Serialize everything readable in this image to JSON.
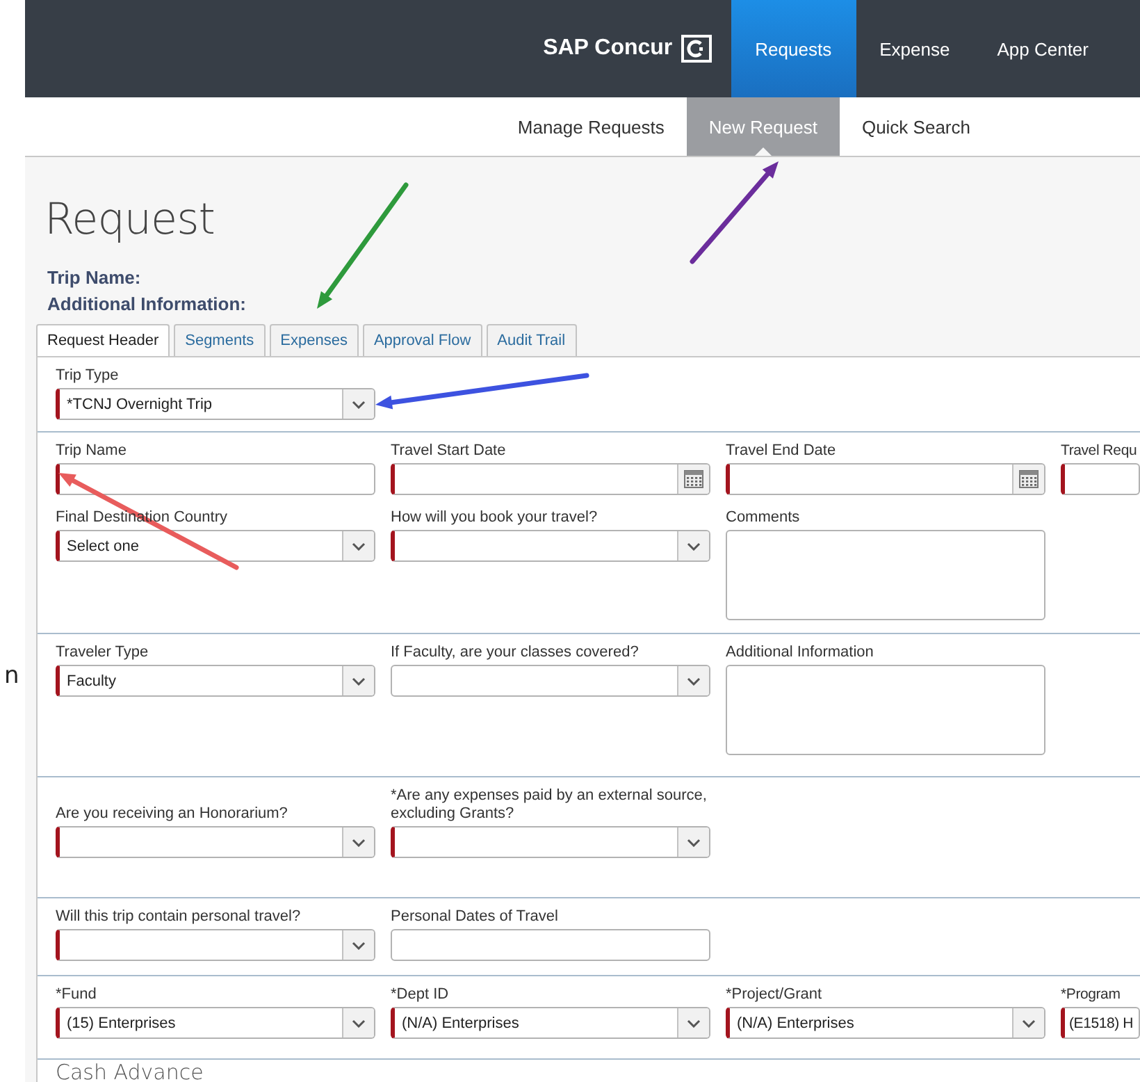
{
  "side_text": "n",
  "top_bar": {
    "logo": "SAP Concur",
    "nav": [
      {
        "label": "Requests",
        "selected": true
      },
      {
        "label": "Expense",
        "selected": false
      },
      {
        "label": "App Center",
        "selected": false
      }
    ]
  },
  "sub_nav": [
    {
      "label": "Manage Requests",
      "selected": false
    },
    {
      "label": "New Request",
      "selected": true
    },
    {
      "label": "Quick Search",
      "selected": false
    }
  ],
  "page_title": "Request",
  "header_labels": [
    "Trip Name:",
    "Additional Information:"
  ],
  "tabs": [
    {
      "label": "Request Header",
      "selected": true
    },
    {
      "label": "Segments",
      "selected": false
    },
    {
      "label": "Expenses",
      "selected": false
    },
    {
      "label": "Approval Flow",
      "selected": false
    },
    {
      "label": "Audit Trail",
      "selected": false
    }
  ],
  "sections": [
    {
      "rows": [
        [
          {
            "label": "Trip Type",
            "kind": "select",
            "value": "*TCNJ Overnight Trip",
            "required": true
          }
        ]
      ]
    },
    {
      "rows": [
        [
          {
            "label": "Trip Name",
            "kind": "text",
            "required": true
          },
          {
            "label": "Travel Start Date",
            "kind": "date",
            "required": true
          },
          {
            "label": "Travel End Date",
            "kind": "date",
            "required": true
          },
          {
            "label": "Travel Requ",
            "kind": "text",
            "required": true
          }
        ],
        [
          {
            "label": "Final Destination Country",
            "kind": "select",
            "value": "Select one",
            "required": true
          },
          {
            "label": "How will you book your travel?",
            "kind": "select",
            "required": true
          },
          {
            "label": "Comments",
            "kind": "textarea",
            "required": false
          }
        ]
      ]
    },
    {
      "rows": [
        [
          {
            "label": "Traveler Type",
            "kind": "select",
            "value": "Faculty",
            "required": true
          },
          {
            "label": "If Faculty, are your classes covered?",
            "kind": "select",
            "required": false
          },
          {
            "label": "Additional Information",
            "kind": "textarea",
            "required": false
          }
        ]
      ]
    },
    {
      "rows": [
        [
          {
            "label": "Are you receiving an Honorarium?",
            "kind": "select",
            "required": true
          },
          {
            "label": "*Are any expenses paid by an external source, excluding Grants?",
            "kind": "select",
            "required": true
          }
        ]
      ]
    },
    {
      "rows": [
        [
          {
            "label": "Will this trip contain personal travel?",
            "kind": "select",
            "required": true
          },
          {
            "label": "Personal Dates of Travel",
            "kind": "text",
            "required": false
          }
        ]
      ]
    },
    {
      "rows": [
        [
          {
            "label": "*Fund",
            "kind": "select",
            "value": "(15) Enterprises",
            "required": true
          },
          {
            "label": "*Dept ID",
            "kind": "select",
            "value": "(N/A) Enterprises",
            "required": true
          },
          {
            "label": "*Project/Grant",
            "kind": "select",
            "value": "(N/A) Enterprises",
            "required": true
          },
          {
            "label": "*Program",
            "kind": "text",
            "value": "(E1518) H",
            "required": true
          }
        ]
      ]
    }
  ],
  "next_section_title": "Cash Advance",
  "annotation_arrows": [
    {
      "color": "#2e9a3c"
    },
    {
      "color": "#6b2d9c"
    },
    {
      "color": "#3d52e0"
    },
    {
      "color": "#e85c5c"
    }
  ]
}
